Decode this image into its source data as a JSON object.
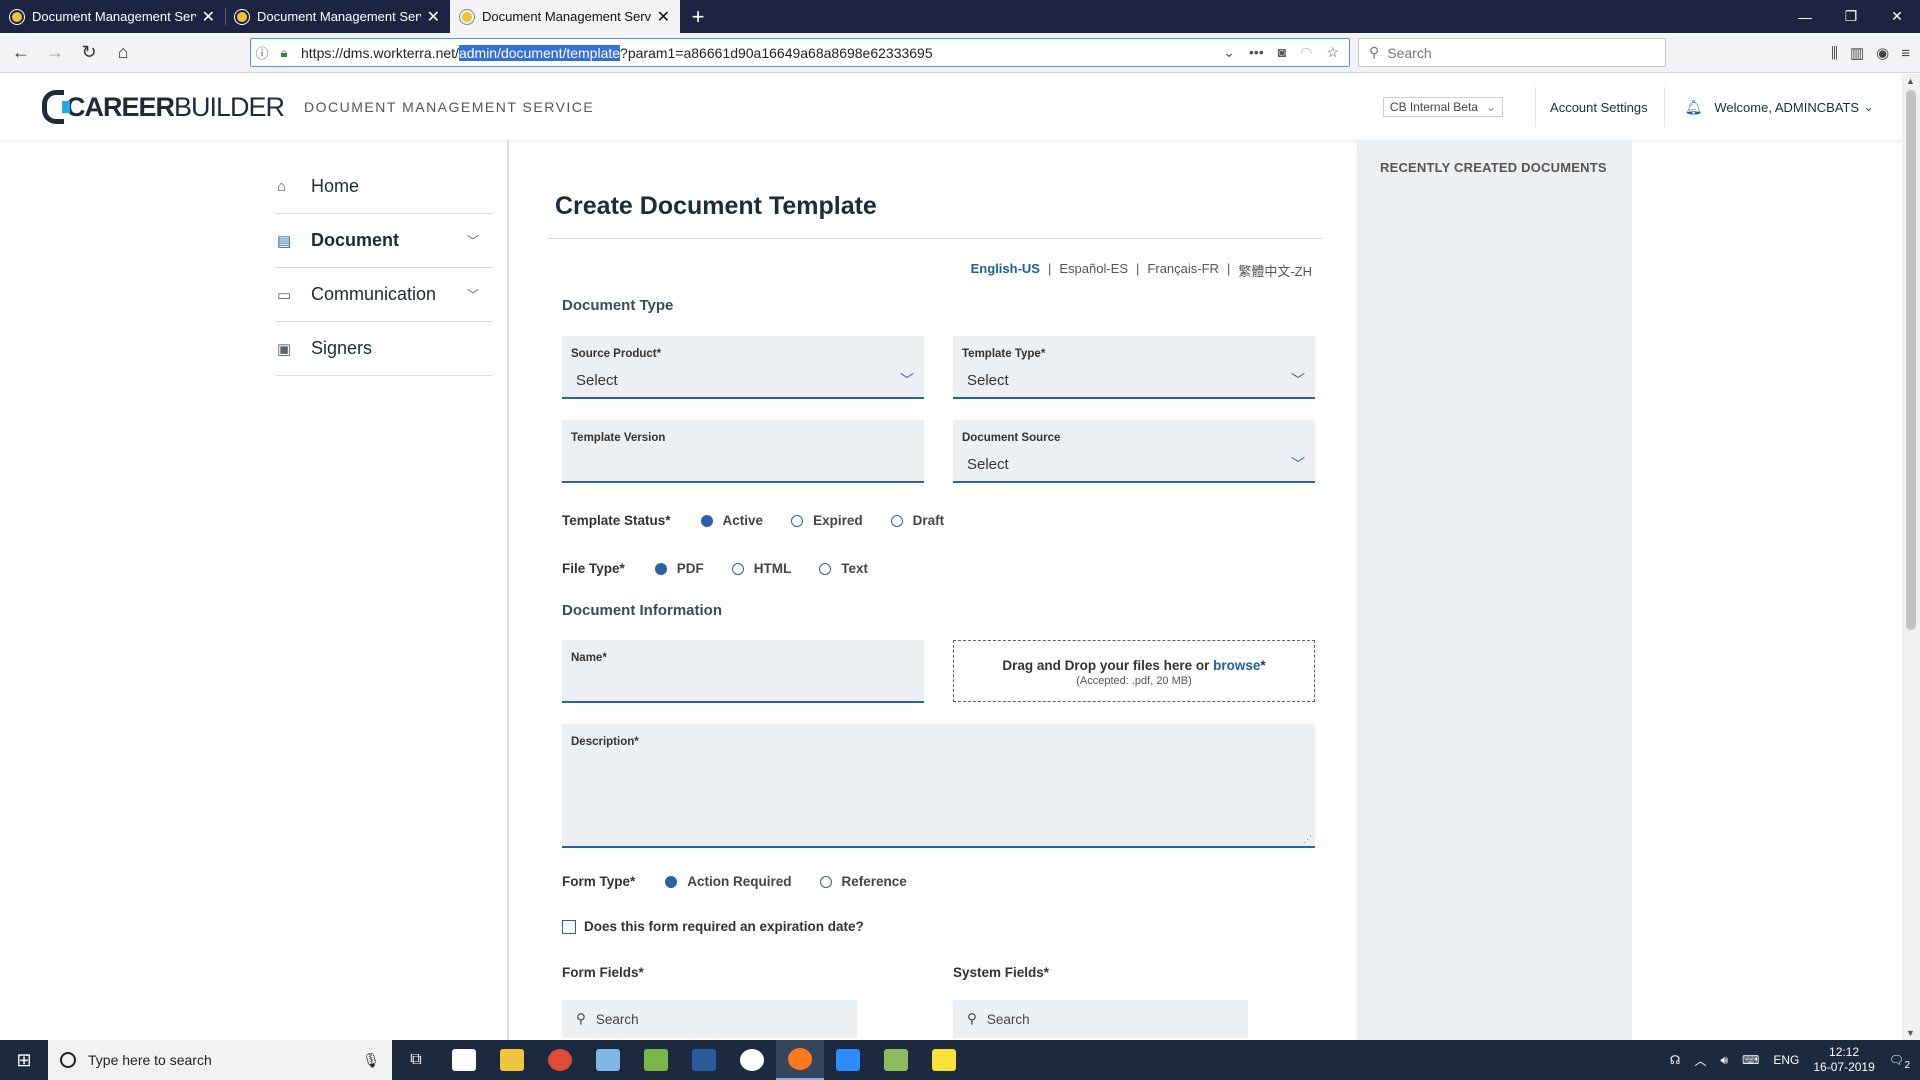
{
  "browser": {
    "tabs": [
      {
        "title": "Document Management Servic",
        "active": false
      },
      {
        "title": "Document Management Servic",
        "active": false
      },
      {
        "title": "Document Management Servic",
        "active": true
      }
    ],
    "new_tab_icon": "plus-icon",
    "url_prefix": "https://dms.workterra.net/",
    "url_selected": "admin/document/template",
    "url_suffix": "?param1=a86661d90a16649a68a8698e62333695",
    "search_placeholder": "Search"
  },
  "header": {
    "logo_bold": "CAREER",
    "logo_light": "BUILDER",
    "app_title": "DOCUMENT MANAGEMENT SERVICE",
    "environment": "CB Internal Beta",
    "account_settings": "Account Settings",
    "welcome": "Welcome, ADMINCBATS"
  },
  "sidebar": {
    "items": [
      {
        "label": "Home",
        "icon": "home-icon"
      },
      {
        "label": "Document",
        "icon": "document-icon"
      },
      {
        "label": "Communication",
        "icon": "chat-icon"
      },
      {
        "label": "Signers",
        "icon": "badge-icon"
      }
    ]
  },
  "main": {
    "title": "Create Document Template",
    "languages": [
      "English-US",
      "Español-ES",
      "Français-FR",
      "繁體中文-ZH"
    ],
    "language_separator": "|",
    "section_document_type": "Document Type",
    "source_product": {
      "label": "Source Product*",
      "value": "Select"
    },
    "template_type": {
      "label": "Template Type*",
      "value": "Select"
    },
    "template_version": {
      "label": "Template Version",
      "value": ""
    },
    "document_source": {
      "label": "Document Source",
      "value": "Select"
    },
    "template_status": {
      "label": "Template Status*",
      "options": [
        "Active",
        "Expired",
        "Draft"
      ],
      "selected": "Active"
    },
    "file_type": {
      "label": "File Type*",
      "options": [
        "PDF",
        "HTML",
        "Text"
      ],
      "selected": "PDF"
    },
    "section_document_info": "Document Information",
    "name": {
      "label": "Name*",
      "value": ""
    },
    "dropzone": {
      "text": "Drag and Drop your files here or ",
      "link": "browse",
      "required": "*",
      "note": "(Accepted: .pdf, 20 MB)"
    },
    "description": {
      "label": "Description*",
      "value": ""
    },
    "form_type": {
      "label": "Form Type*",
      "options": [
        "Action Required",
        "Reference"
      ],
      "selected": "Action Required"
    },
    "expiration_checkbox": {
      "label": "Does this form required an expiration date?",
      "checked": false
    },
    "form_fields": {
      "label": "Form Fields*",
      "placeholder": "Search"
    },
    "system_fields": {
      "label": "System Fields*",
      "placeholder": "Search"
    }
  },
  "right_panel": {
    "title": "RECENTLY CREATED DOCUMENTS"
  },
  "taskbar": {
    "search_placeholder": "Type here to search",
    "language": "ENG",
    "time": "12:12",
    "date": "16-07-2019",
    "notification_count": "2"
  },
  "colors": {
    "accent": "#2962a8",
    "link": "#1f5fa6",
    "field_bg": "#edf0f3",
    "tabstrip_bg": "#1d2442",
    "taskbar_bg": "#1b2a3f"
  }
}
